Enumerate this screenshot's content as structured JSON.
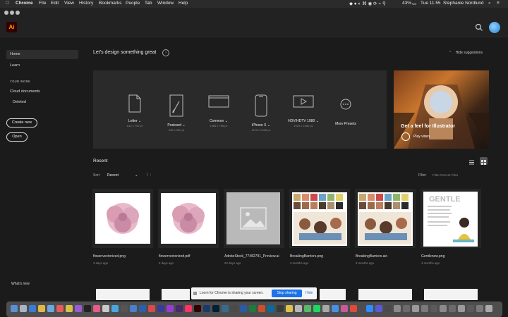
{
  "menubar": {
    "apple": "",
    "app": "Chrome",
    "items": [
      "File",
      "Edit",
      "View",
      "History",
      "Bookmarks",
      "People",
      "Tab",
      "Window",
      "Help"
    ],
    "battery": "43%",
    "clock": "Tue 11:55",
    "user": "Stephanie Nordlund"
  },
  "header": {
    "logo": "Ai"
  },
  "sidebar": {
    "home": "Home",
    "learn": "Learn",
    "section": "YOUR WORK",
    "cloud": "Cloud documents",
    "deleted": "Deleted",
    "create_new": "Create new",
    "open": "Open",
    "whats_new": "What's new"
  },
  "main": {
    "title": "Let's design something great",
    "hide_suggestions": "Hide suggestions",
    "presets": [
      {
        "label": "Letter",
        "sub": "612 x 792 pt",
        "icon": "document-icon"
      },
      {
        "label": "Postcard",
        "sub": "288 x 560 pt",
        "icon": "brush-icon"
      },
      {
        "label": "Common",
        "sub": "1366 x 768 px",
        "icon": "screen-icon"
      },
      {
        "label": "iPhone X",
        "sub": "1125 x 2436 px",
        "icon": "phone-icon"
      },
      {
        "label": "HDV/HDTV 1080",
        "sub": "1920 x 1080 px",
        "icon": "video-icon"
      },
      {
        "label": "More Presets",
        "sub": "",
        "icon": "more-icon"
      }
    ],
    "promo": {
      "title": "Get a feel for Illustrator",
      "play": "Play video"
    },
    "recent": {
      "title": "Recent",
      "sort_label": "Sort",
      "sort_value": "Recent",
      "filter_label": "Filter",
      "filter_placeholder": "Filter Recent Files",
      "files": [
        {
          "name": "flowervectorized.png",
          "date": "3 days ago",
          "thumb": "flower"
        },
        {
          "name": "flowervectorized.pdf",
          "date": "3 days ago",
          "thumb": "flower"
        },
        {
          "name": "AdobeStock_77482791_Preview.ai",
          "date": "20 days ago",
          "thumb": "placeholder"
        },
        {
          "name": "BreakingBarriers.png",
          "date": "3 months ago",
          "thumb": "collage"
        },
        {
          "name": "BreakingBarriers.aic",
          "date": "3 months ago",
          "thumb": "collage"
        },
        {
          "name": "Gentlenew.png",
          "date": "4 months ago",
          "thumb": "gentle"
        }
      ]
    }
  },
  "share_bar": {
    "text": "Loom for Chrome is sharing your screen.",
    "stop": "Stop sharing",
    "hide": "Hide"
  },
  "colors": {
    "ai_logo_bg": "#330000",
    "ai_logo_fg": "#ff9a00",
    "panel": "#2a2a2a",
    "accent": "#1a73e8"
  }
}
